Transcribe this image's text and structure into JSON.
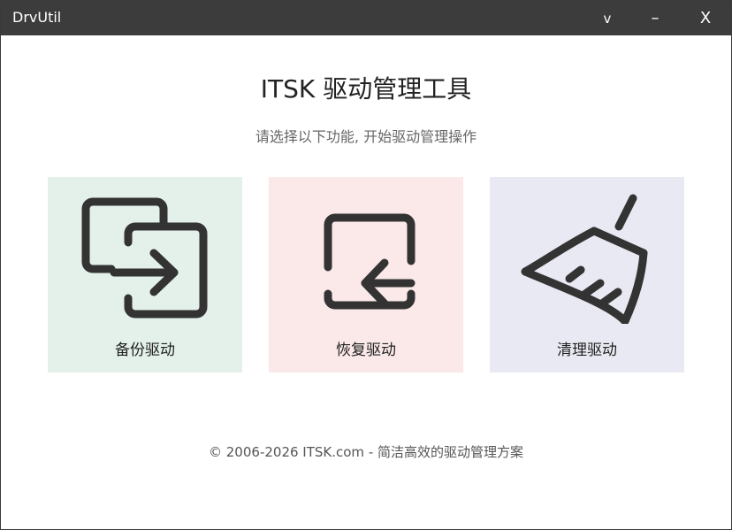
{
  "window": {
    "app_title": "DrvUtil",
    "controls": {
      "collapse": "v",
      "minimize": "–",
      "close": "X"
    }
  },
  "header": {
    "title": "ITSK 驱动管理工具",
    "subtitle": "请选择以下功能, 开始驱动管理操作"
  },
  "cards": [
    {
      "label": "备份驱动",
      "icon": "backup-icon",
      "color": "#e3f1ea"
    },
    {
      "label": "恢复驱动",
      "icon": "restore-icon",
      "color": "#fbe9ea"
    },
    {
      "label": "清理驱动",
      "icon": "broom-icon",
      "color": "#e9e9f3"
    }
  ],
  "footer": {
    "copyright": "© 2006-2026 ITSK.com - 简洁高效的驱动管理方案"
  },
  "colors": {
    "titlebar": "#3c3c3c",
    "icon_stroke": "#333333"
  }
}
